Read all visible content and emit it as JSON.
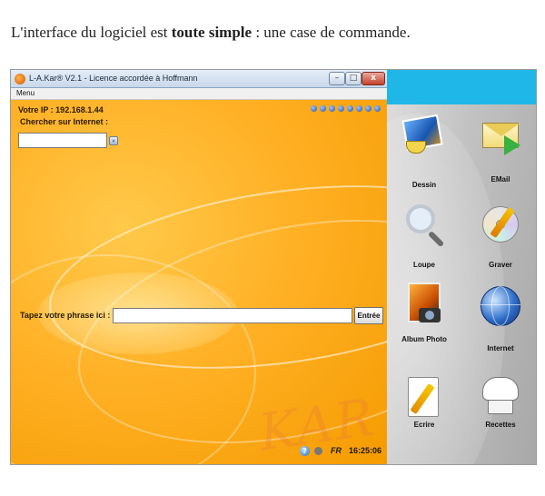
{
  "caption": {
    "before": "L'interface du logiciel est ",
    "bold": "toute simple",
    "after": " : une case de commande."
  },
  "window": {
    "title": "L-A.Kar® V2.1 - Licence accordée à Hoffmann",
    "buttons": {
      "minimize": "–",
      "maximize": "□",
      "close": "x"
    },
    "menu": "Menu"
  },
  "panel": {
    "ip_text": "Votre IP : 192.168.1.44",
    "search_label": "Chercher sur Internet :",
    "search_value": "",
    "search_go": "»",
    "phrase_label": "Tapez votre phrase ici :",
    "phrase_value": "",
    "enter_button": "Entrée",
    "watermark": "KAR",
    "status": {
      "help": "?",
      "lang": "FR",
      "time": "16:25:06"
    },
    "colors": {
      "panel": "#ffb126",
      "accent": "#f59b00"
    }
  },
  "launcher": {
    "apps": [
      {
        "label": "Dessin",
        "icon": "paint-icon"
      },
      {
        "label": "EMail",
        "icon": "email-icon"
      },
      {
        "label": "Loupe",
        "icon": "magnifier-icon"
      },
      {
        "label": "Graver",
        "icon": "cd-burn-icon"
      },
      {
        "label": "Album Photo",
        "icon": "photo-album-icon"
      },
      {
        "label": "Internet",
        "icon": "globe-icon"
      },
      {
        "label": "Ecrire",
        "icon": "notepad-icon"
      },
      {
        "label": "Recettes",
        "icon": "chef-hat-icon"
      }
    ],
    "colors": {
      "sky": "#1fb7e8",
      "background": "#c2c2c2"
    }
  }
}
